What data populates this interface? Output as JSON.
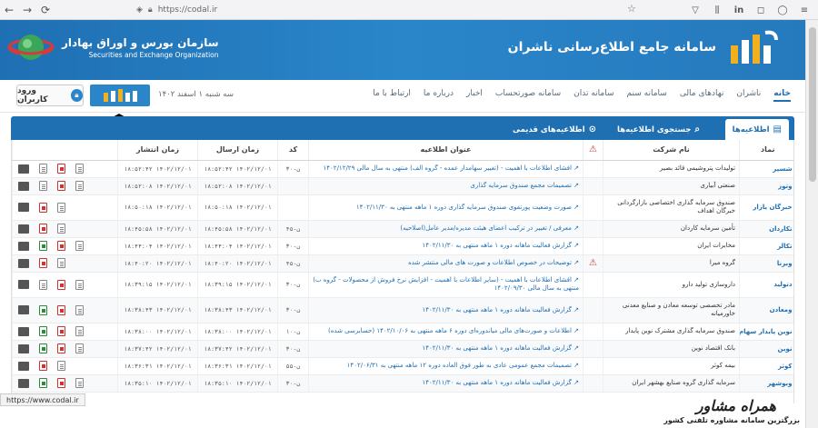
{
  "browser": {
    "url": "https://codal.ir",
    "status_url": "https://www.codal.ir"
  },
  "header": {
    "site_title": "سامانه جامع اطلاع‌رسانی ناشران",
    "org_name_fa": "سازمان بورس و اوراق بهادار",
    "org_name_en": "Securities and Exchange Organization",
    "brand_colors": {
      "primary": "#1f6fb3",
      "accent": "#f2b01e"
    }
  },
  "menu": {
    "items": [
      "خانه",
      "ناشران",
      "نهادهای مالی",
      "سامانه سنم",
      "سامانه تدان",
      "سامانه صورتحساب",
      "اخبار",
      "درباره ما",
      "ارتباط با ما"
    ],
    "active_index": 0,
    "date": "سه شنبه ۱ اسفند ۱۴۰۲",
    "login_label": "ورود کاربران"
  },
  "tabs": [
    {
      "label": "اطلاعیه‌ها",
      "icon": "list-icon",
      "active": true
    },
    {
      "label": "جستجوی اطلاعیه‌ها",
      "icon": "search-icon",
      "active": false
    },
    {
      "label": "اطلاعیه‌های قدیمی",
      "icon": "history-icon",
      "active": false
    }
  ],
  "table": {
    "headers": {
      "symbol": "نماد",
      "company": "نام شرکت",
      "warning": "",
      "title": "عنوان اطلاعیه",
      "code": "کد",
      "sent": "زمان ارسال",
      "published": "زمان انتشار",
      "attachments": ""
    },
    "rows": [
      {
        "symbol": "شسپر",
        "company": "تولیدات پتروشیمی قائد بصیر",
        "warn": false,
        "title": "افشای اطلاعات با اهمیت - (تغییر سهامدار عمده - گروه الف) منتهی به سال مالی ۱۴۰۲/۱۲/۲۹",
        "code": "ن-۳۰",
        "sent": "۱۴۰۲/۱۲/۰۱ ۱۸:۵۲:۴۲",
        "published": "۱۴۰۲/۱۲/۰۱ ۱۸:۵۲:۴۲",
        "files": [
          "doc",
          "pdf",
          "doc",
          "att"
        ],
        "tall": false
      },
      {
        "symbol": "وتوز",
        "company": "صنعتی آبیاری",
        "warn": false,
        "title": "تصمیمات مجمع صندوق سرمایه گذاری",
        "code": "",
        "sent": "۱۴۰۲/۱۲/۰۱ ۱۸:۵۲:۰۸",
        "published": "۱۴۰۲/۱۲/۰۱ ۱۸:۵۲:۰۸",
        "files": [
          "doc",
          "pdf",
          "doc",
          "att"
        ],
        "tall": false
      },
      {
        "symbol": "خبرگان بازار",
        "company": "صندوق سرمایه گذاری اختصاصی بازارگردانی خبرگان اهداف",
        "warn": false,
        "title": "صورت وضعیت پورتفوی صندوق سرمایه گذاری دوره ۱ ماهه منتهی به ۱۴۰۲/۱۱/۳۰",
        "code": "",
        "sent": "۱۴۰۲/۱۲/۰۱ ۱۸:۵۰:۱۸",
        "published": "۱۴۰۲/۱۲/۰۱ ۱۸:۵۰:۱۸",
        "files": [
          "doc",
          "pdf",
          "att"
        ],
        "tall": true
      },
      {
        "symbol": "تکاردان",
        "company": "تأمین سرمایه کاردان",
        "warn": false,
        "title": "معرفی / تغییر در ترکیب اعضای هیئت مدیره/مدیر عامل(اصلاحیه)",
        "code": "ن-۴۵",
        "sent": "۱۴۰۲/۱۲/۰۱ ۱۸:۴۵:۵۸",
        "published": "۱۴۰۲/۱۲/۰۱ ۱۸:۴۵:۵۸",
        "files": [
          "doc",
          "pdf",
          "att"
        ],
        "tall": false
      },
      {
        "symbol": "تکالر",
        "company": "مخابرات ایران",
        "warn": false,
        "title": "گزارش فعالیت ماهانه دوره ۱ ماهه منتهی به ۱۴۰۲/۱۱/۳۰",
        "code": "ن-۳۰",
        "sent": "۱۴۰۲/۱۲/۰۱ ۱۸:۴۴:۰۴",
        "published": "۱۴۰۲/۱۲/۰۱ ۱۸:۴۴:۰۴",
        "files": [
          "doc",
          "pdf",
          "xls",
          "att"
        ],
        "tall": false
      },
      {
        "symbol": "وبرنا",
        "company": "گروه میرا",
        "warn": true,
        "title": "توضیحات در خصوص اطلاعات و صورت های مالی منتشر شده",
        "code": "ن-۴۵",
        "sent": "۱۴۰۲/۱۲/۰۱ ۱۸:۴۰:۲۰",
        "published": "۱۴۰۲/۱۲/۰۱ ۱۸:۴۰:۲۰",
        "files": [
          "doc",
          "pdf",
          "att"
        ],
        "tall": false
      },
      {
        "symbol": "دتولید",
        "company": "داروسازی تولید دارو",
        "warn": false,
        "title": "افشای اطلاعات با اهمیت - (سایر اطلاعات با اهمیت - افزایش نرخ فروش از محصولات - گروه ب) منتهی به سال مالی ۱۴۰۲/۰۹/۳۰",
        "code": "ن-۳۰",
        "sent": "۱۴۰۲/۱۲/۰۱ ۱۸:۳۹:۱۵",
        "published": "۱۴۰۲/۱۲/۰۱ ۱۸:۳۹:۱۵",
        "files": [
          "doc",
          "pdf",
          "doc",
          "att"
        ],
        "tall": true
      },
      {
        "symbol": "ومعادن",
        "company": "مادر تخصصی توسعه معادن و صنایع معدنی خاورمیانه",
        "warn": false,
        "title": "گزارش فعالیت ماهانه دوره ۱ ماهه منتهی به ۱۴۰۲/۱۱/۳۰",
        "code": "ن-۳۰",
        "sent": "۱۴۰۲/۱۲/۰۱ ۱۸:۳۸:۴۳",
        "published": "۱۴۰۲/۱۲/۰۱ ۱۸:۳۸:۴۳",
        "files": [
          "doc",
          "pdf",
          "xls",
          "att"
        ],
        "tall": true
      },
      {
        "symbol": "نوین پایدار سهام",
        "company": "صندوق سرمایه گذاری مشترک نوین پایدار",
        "warn": false,
        "title": "اطلاعات و صورت‌های مالی میاندوره‌ای دوره ۶ ماهه منتهی به ۱۴۰۲/۱۰/۰۶ (حسابرسی شده)",
        "code": "ن-۱۰",
        "sent": "۱۴۰۲/۱۲/۰۱ ۱۸:۳۸:۰۰",
        "published": "۱۴۰۲/۱۲/۰۱ ۱۸:۳۸:۰۰",
        "files": [
          "doc",
          "pdf",
          "xls",
          "att"
        ],
        "tall": false
      },
      {
        "symbol": "نوبن",
        "company": "بانک اقتصاد نوین",
        "warn": false,
        "title": "گزارش فعالیت ماهانه دوره ۱ ماهه منتهی به ۱۴۰۲/۱۱/۳۰",
        "code": "ن-۳۰",
        "sent": "۱۴۰۲/۱۲/۰۱ ۱۸:۳۷:۴۲",
        "published": "۱۴۰۲/۱۲/۰۱ ۱۸:۳۷:۴۲",
        "files": [
          "doc",
          "pdf",
          "xls",
          "att"
        ],
        "tall": false
      },
      {
        "symbol": "کوثر",
        "company": "بیمه کوثر",
        "warn": false,
        "title": "تصمیمات مجمع عمومی عادی به طور فوق العاده دوره ۱۲ ماهه منتهی به ۱۴۰۲/۰۶/۳۱",
        "code": "ن-۵۵",
        "sent": "۱۴۰۲/۱۲/۰۱ ۱۸:۳۶:۳۱",
        "published": "۱۴۰۲/۱۲/۰۱ ۱۸:۳۶:۳۱",
        "files": [
          "doc",
          "pdf",
          "att"
        ],
        "tall": false
      },
      {
        "symbol": "وبوشهر",
        "company": "سرمایه گذاری گروه صنایع بهشهر ایران",
        "warn": false,
        "title": "گزارش فعالیت ماهانه دوره ۱ ماهه منتهی به ۱۴۰۲/۱۱/۳۰",
        "code": "ن-۳۰",
        "sent": "۱۴۰۲/۱۲/۰۱ ۱۸:۳۵:۱۰",
        "published": "۱۴۰۲/۱۲/۰۱ ۱۸:۳۵:۱۰",
        "files": [
          "doc",
          "pdf",
          "xls",
          "att"
        ],
        "tall": false
      }
    ]
  },
  "watermark": {
    "name": "همراه مشاور",
    "tagline": "بزرگترین سامانه مشاوره تلفنی کشور"
  }
}
